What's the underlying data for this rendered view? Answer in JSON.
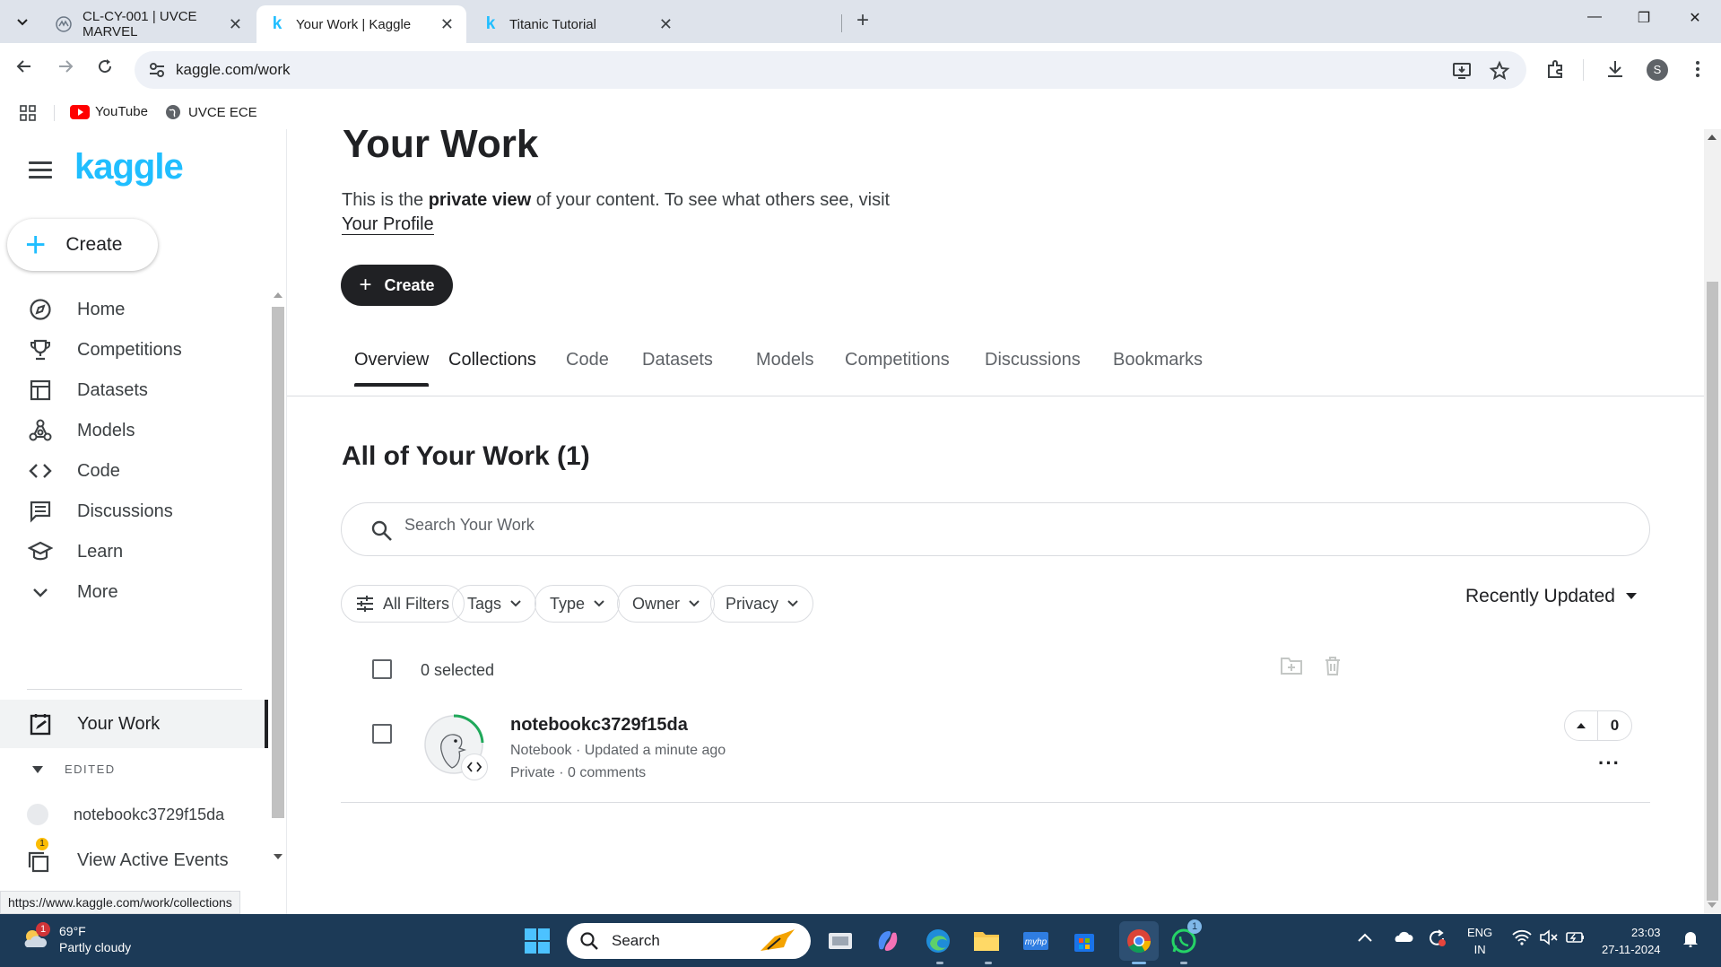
{
  "browser": {
    "tabs": [
      {
        "title": "CL-CY-001 | UVCE MARVEL"
      },
      {
        "title": "Your Work | Kaggle"
      },
      {
        "title": "Titanic Tutorial"
      }
    ],
    "url": "kaggle.com/work",
    "bookmarks": [
      {
        "label": "YouTube"
      },
      {
        "label": "UVCE ECE"
      }
    ],
    "profile_initial": "S",
    "status_url": "https://www.kaggle.com/work/collections"
  },
  "sidebar": {
    "logo": "kaggle",
    "create_label": "Create",
    "items": [
      {
        "label": "Home",
        "icon": "compass-icon"
      },
      {
        "label": "Competitions",
        "icon": "trophy-icon"
      },
      {
        "label": "Datasets",
        "icon": "table-icon"
      },
      {
        "label": "Models",
        "icon": "models-icon"
      },
      {
        "label": "Code",
        "icon": "code-icon"
      },
      {
        "label": "Discussions",
        "icon": "discussion-icon"
      },
      {
        "label": "Learn",
        "icon": "school-icon"
      },
      {
        "label": "More",
        "icon": "chevron-down-icon"
      }
    ],
    "your_work": "Your Work",
    "edited_heading": "EDITED",
    "edited_item": "notebookc3729f15da",
    "view_events": "View Active Events",
    "events_badge": "1"
  },
  "main": {
    "title": "Your Work",
    "intro_pre": "This is the ",
    "intro_bold": "private view",
    "intro_post": " of your content. To see what others see, visit ",
    "intro_link": "Your Profile",
    "create_label": "Create",
    "tabs": [
      {
        "label": "Overview"
      },
      {
        "label": "Collections"
      },
      {
        "label": "Code"
      },
      {
        "label": "Datasets"
      },
      {
        "label": "Models"
      },
      {
        "label": "Competitions"
      },
      {
        "label": "Discussions"
      },
      {
        "label": "Bookmarks"
      }
    ],
    "section_title": "All of Your Work (1)",
    "search_placeholder": "Search Your Work",
    "filters": [
      {
        "label": "All Filters"
      },
      {
        "label": "Tags"
      },
      {
        "label": "Type"
      },
      {
        "label": "Owner"
      },
      {
        "label": "Privacy"
      }
    ],
    "sort_label": "Recently Updated",
    "selected_text": "0 selected",
    "item": {
      "name": "notebookc3729f15da",
      "meta": "Notebook · Updated a minute ago",
      "meta2": "Private · 0 comments",
      "votes": "0"
    }
  },
  "taskbar": {
    "weather_temp": "69°F",
    "weather_desc": "Partly cloudy",
    "weather_badge": "1",
    "search_label": "Search",
    "whatsapp_badge": "1",
    "lang_line1": "ENG",
    "lang_line2": "IN",
    "time": "23:03",
    "date": "27-11-2024"
  },
  "colors": {
    "kaggle_blue": "#20beff",
    "dark": "#202124",
    "taskbar": "#1c3a57"
  }
}
